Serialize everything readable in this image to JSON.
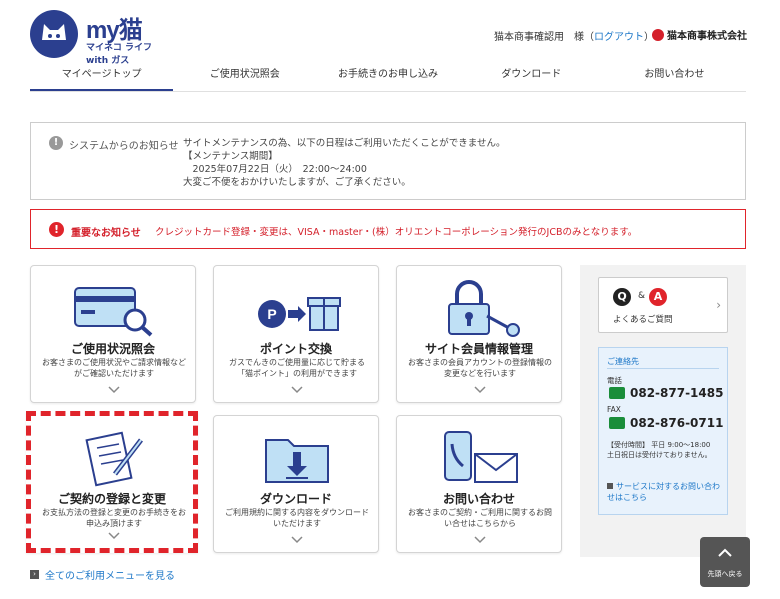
{
  "header": {
    "logo_text": "my猫",
    "logo_sub": "マイネコ ライフ with ガス",
    "user_name": "猫本商事確認用　様",
    "logout_label": "ログアウト",
    "company_name": "猫本商事株式会社"
  },
  "nav": {
    "items": [
      {
        "label": "マイページトップ"
      },
      {
        "label": "ご使用状況照会"
      },
      {
        "label": "お手続きのお申し込み"
      },
      {
        "label": "ダウンロード"
      },
      {
        "label": "お問い合わせ"
      }
    ]
  },
  "notice_system": {
    "label": "システムからのお知らせ",
    "line1": "サイトメンテナンスの為、以下の日程はご利用いただくことができません。",
    "line2": "【メンテナンス期間】",
    "line3": "　2025年07月22日（火）　22:00～24:00",
    "line4": "大変ご不便をおかけいたしますが、ご了承ください。"
  },
  "notice_important": {
    "label": "重要なお知らせ",
    "body": "クレジットカード登録・変更は、VISA・master・(株）オリエントコーポレーション発行のJCBのみとなります。"
  },
  "cards": [
    {
      "title": "ご使用状況照会",
      "desc": "お客さまのご使用状況やご請求情報などがご確認いただけます"
    },
    {
      "title": "ポイント交換",
      "desc": "ガスでんきのご使用量に応じて貯まる「猫ポイント」の利用ができます"
    },
    {
      "title": "サイト会員情報管理",
      "desc": "お客さまの会員アカウントの登録情報の変更などを行います"
    },
    {
      "title": "ご契約の登録と変更",
      "desc": "お支払方法の登録と変更のお手続きをお申込み頂けます"
    },
    {
      "title": "ダウンロード",
      "desc": "ご利用規約に関する内容をダウンロードいただけます"
    },
    {
      "title": "お問い合わせ",
      "desc": "お客さまのご契約・ご利用に関するお問い合せはこちらから"
    }
  ],
  "faq": {
    "q": "Q",
    "amp": "&",
    "a": "A",
    "label": "よくあるご質問"
  },
  "contact": {
    "head": "ご連絡先",
    "tel_label": "電話",
    "tel": "082-877-1485",
    "fax_label": "FAX",
    "fax": "082-876-0711",
    "hours1": "【受付時間】 平日 9:00～18:00",
    "hours2": "土日祝日は受付けておりません。",
    "service_link": "サービスに対するお問い合わせはこちら"
  },
  "all_menu_link": "全てのご利用メニューを見る",
  "to_top_label": "先頭へ戻る",
  "colors": {
    "brand": "#2b3f8f",
    "alert": "#e0242b",
    "link": "#1e78c8",
    "phone": "#1a8d3a"
  }
}
